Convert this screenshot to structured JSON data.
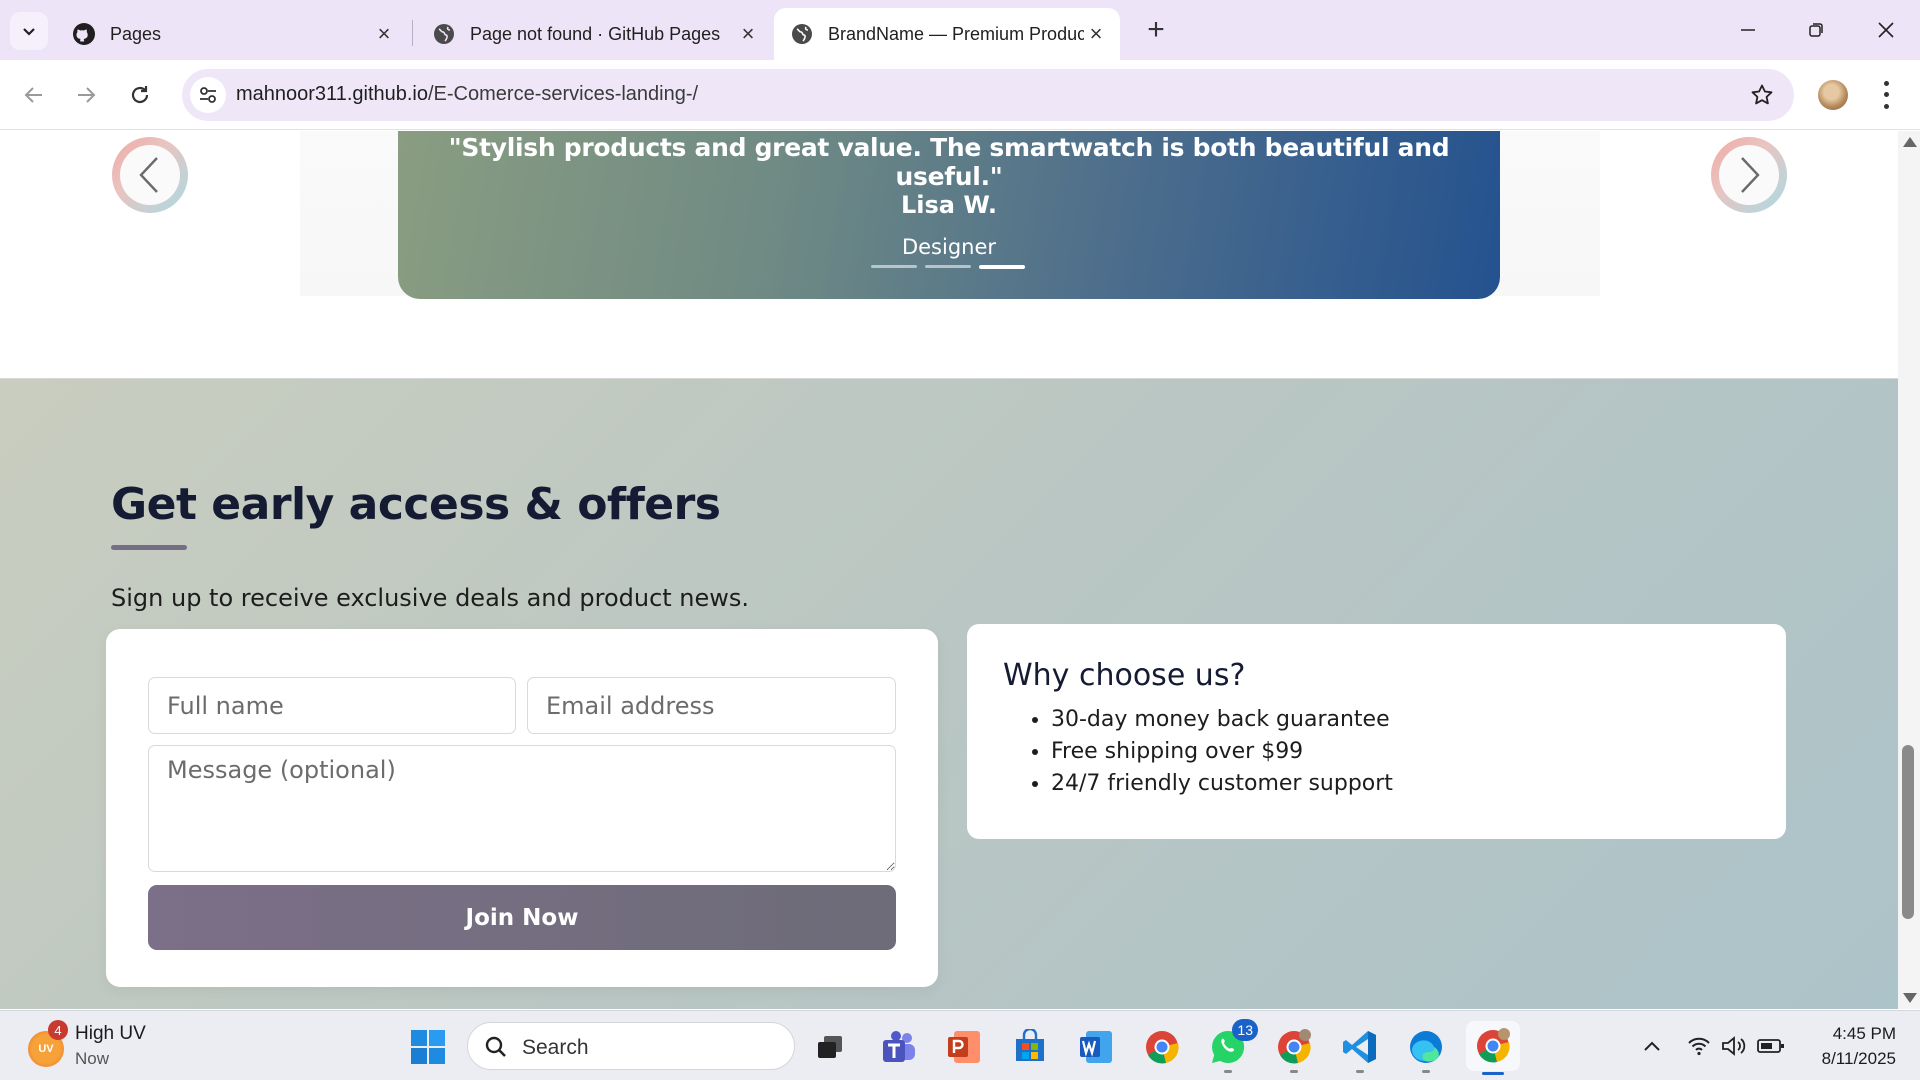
{
  "browser": {
    "tabs": [
      {
        "title": "Pages",
        "favicon": "github-icon"
      },
      {
        "title": "Page not found · GitHub Pages",
        "favicon": "globe-icon"
      },
      {
        "title": "BrandName — Premium Produc",
        "favicon": "globe-icon",
        "active": true
      }
    ],
    "url": {
      "host": "mahnoor311.github.io",
      "path": "/E-Comerce-services-landing-/"
    }
  },
  "testimonial": {
    "quote": "\"Stylish products and great value. The smartwatch is both beautiful and useful.\"",
    "author": "Lisa W.",
    "role": "Designer",
    "slides": 3,
    "active_slide": 3
  },
  "signup": {
    "heading": "Get early access & offers",
    "lead": "Sign up to receive exclusive deals and product news.",
    "form": {
      "name_placeholder": "Full name",
      "email_placeholder": "Email address",
      "message_placeholder": "Message (optional)",
      "submit_label": "Join Now"
    },
    "why": {
      "title": "Why choose us?",
      "items": [
        "30-day money back guarantee",
        "Free shipping over $99",
        "24/7 friendly customer support"
      ]
    }
  },
  "taskbar": {
    "weather": {
      "title": "High UV",
      "subtitle": "Now",
      "badge": "4",
      "icon_text": "UV"
    },
    "search_label": "Search",
    "whatsapp_badge": "13",
    "clock": {
      "time": "4:45 PM",
      "date": "8/11/2025"
    }
  },
  "colors": {
    "accent": "#756e87",
    "heading": "#141b33",
    "card_gradient_start": "#8a9d82",
    "card_gradient_end": "#24528f"
  }
}
